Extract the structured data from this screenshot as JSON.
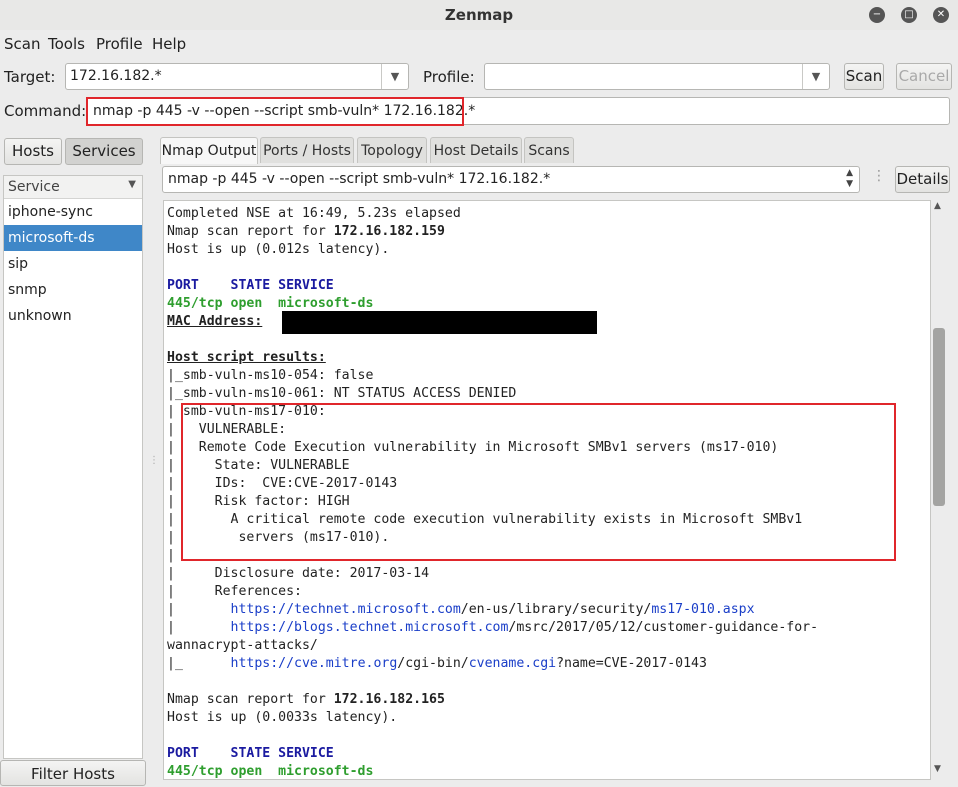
{
  "window": {
    "title": "Zenmap"
  },
  "menu": [
    "Scan",
    "Tools",
    "Profile",
    "Help"
  ],
  "toolbar": {
    "target_label": "Target:",
    "target_value": "172.16.182.*",
    "profile_label": "Profile:",
    "profile_value": "",
    "scan_button": "Scan",
    "cancel_button": "Cancel",
    "command_label": "Command:",
    "command_value": "nmap -p 445 -v --open --script smb-vuln* 172.16.182.*"
  },
  "left_pane": {
    "hosts_button": "Hosts",
    "services_button": "Services",
    "column_header": "Service",
    "services": [
      "iphone-sync",
      "microsoft-ds",
      "sip",
      "snmp",
      "unknown"
    ],
    "selected_service": "microsoft-ds",
    "filter_button": "Filter Hosts"
  },
  "tabs": [
    "Nmap Output",
    "Ports / Hosts",
    "Topology",
    "Host Details",
    "Scans"
  ],
  "active_tab": "Nmap Output",
  "output_selector": "nmap -p 445 -v --open --script smb-vuln* 172.16.182.*",
  "details_button": "Details",
  "output": {
    "l1": "Completed NSE at 16:49, 5.23s elapsed",
    "l2a": "Nmap scan report for ",
    "l2b": "172.16.182.159",
    "l3": "Host is up (0.012s latency).",
    "l5": "PORT    STATE SERVICE",
    "l6": "445/tcp open  microsoft-ds",
    "l7": "MAC Address:",
    "l9": "Host script results:",
    "l10": "|_smb-vuln-ms10-054: false",
    "l11": "|_smb-vuln-ms10-061: NT STATUS ACCESS DENIED",
    "l12": "| smb-vuln-ms17-010:",
    "l13": "|   VULNERABLE:",
    "l14": "|   Remote Code Execution vulnerability in Microsoft SMBv1 servers (ms17-010)",
    "l15": "|     State: VULNERABLE",
    "l16": "|     IDs:  CVE:CVE-2017-0143",
    "l17": "|     Risk factor: HIGH",
    "l18": "|       A critical remote code execution vulnerability exists in Microsoft SMBv1",
    "l19": "|        servers (ms17-010).",
    "l20": "|",
    "l21": "|     Disclosure date: 2017-03-14",
    "l22": "|     References:",
    "ref1_prefix": "|       ",
    "ref1_host": "https://technet.microsoft.com",
    "ref1_path": "/en-us/library/security/",
    "ref1_file": "ms17-010.aspx",
    "ref2_prefix": "|       ",
    "ref2_host": "https://blogs.technet.microsoft.com",
    "ref2_path": "/msrc/2017/05/12/customer-guidance-for-",
    "ref2_cont": "wannacrypt-attacks/",
    "ref3_prefix": "|_      ",
    "ref3_host": "https://cve.mitre.org",
    "ref3_path": "/cgi-bin/",
    "ref3_file": "cvename.cgi",
    "ref3_query": "?name=CVE-2017-0143",
    "l28a": "Nmap scan report for ",
    "l28b": "172.16.182.165",
    "l29": "Host is up (0.0033s latency).",
    "l31": "PORT    STATE SERVICE",
    "l32": "445/tcp open  microsoft-ds"
  },
  "colors": {
    "highlight_red": "#e0262b",
    "selection_blue": "#3f87c8",
    "link_blue": "#1a3ec8"
  }
}
